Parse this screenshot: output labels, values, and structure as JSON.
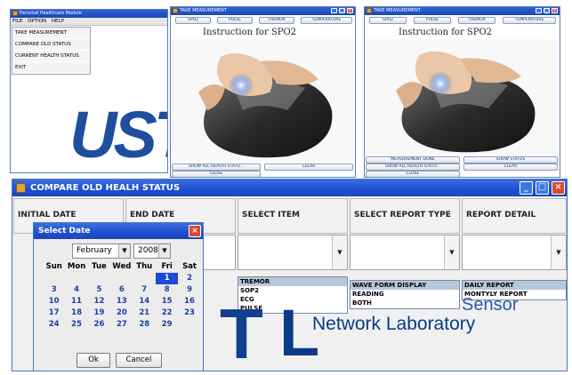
{
  "phm": {
    "title": "Personal Healthcare Module",
    "menu": [
      "FILE",
      "OPTION",
      "HELP"
    ],
    "dropdown": [
      "TAKE MEASUREMENT",
      "COMPARE OLD STATUS",
      "CURRENT HEALTH STATUS",
      "EXIT"
    ]
  },
  "tm1": {
    "title": "TAKE MEASUREMENT",
    "tabs": [
      "SPO2",
      "PULSE",
      "TREMOR",
      "TEMPERATURE"
    ],
    "instruction": "Instruction for SPO2",
    "bottom_left": "SHOW ALL HEALTH STATU...",
    "bottom_right": "CLEAR",
    "close": "CLOSE"
  },
  "tm2": {
    "title": "TAKE MEASUREMENT",
    "tabs": [
      "SPO2",
      "PULSE",
      "TREMOR",
      "TEMPERATURE"
    ],
    "instruction": "Instruction for SPO2",
    "measure_done": "MEASUREMENT DONE",
    "show_status": "SHOW STATUS",
    "bottom_left": "SHOW ALL HEALTH STATU...",
    "bottom_right": "CLEAR",
    "close": "CLOSE"
  },
  "compare": {
    "title": "COMPARE OLD HEALH STATUS",
    "headers": [
      "INITIAL DATE",
      "END DATE",
      "SELECT ITEM",
      "SELECT REPORT TYPE",
      "REPORT DETAIL"
    ],
    "item_options": [
      "TREMOR",
      "SOP2",
      "ECG",
      "PULSE"
    ],
    "report_type_options": [
      "WAVE FORM DISPLAY",
      "READING",
      "BOTH"
    ],
    "report_detail_options": [
      "DAILY REPORT",
      "MONTYLY REPORT"
    ]
  },
  "watermark": {
    "logo_left": "UST",
    "logo_bottom_letter": "T",
    "brand_letter": "L",
    "line1": "Sensor",
    "line2": "Network Laboratory"
  },
  "date_dialog": {
    "title": "Select Date",
    "month": "February",
    "year": "2008",
    "weekdays": [
      "Sun",
      "Mon",
      "Tue",
      "Wed",
      "Thu",
      "Fri",
      "Sat"
    ],
    "weeks": [
      [
        "",
        "",
        "",
        "",
        "",
        "1",
        "2"
      ],
      [
        "3",
        "4",
        "5",
        "6",
        "7",
        "8",
        "9"
      ],
      [
        "10",
        "11",
        "12",
        "13",
        "14",
        "15",
        "16"
      ],
      [
        "17",
        "18",
        "19",
        "20",
        "21",
        "22",
        "23"
      ],
      [
        "24",
        "25",
        "26",
        "27",
        "28",
        "29",
        ""
      ]
    ],
    "selected_day": "1",
    "ok": "Ok",
    "cancel": "Cancel"
  },
  "colors": {
    "titlebar": "#1d4fd0",
    "selection": "#2048d8",
    "brand_blue": "#0b3a86"
  }
}
